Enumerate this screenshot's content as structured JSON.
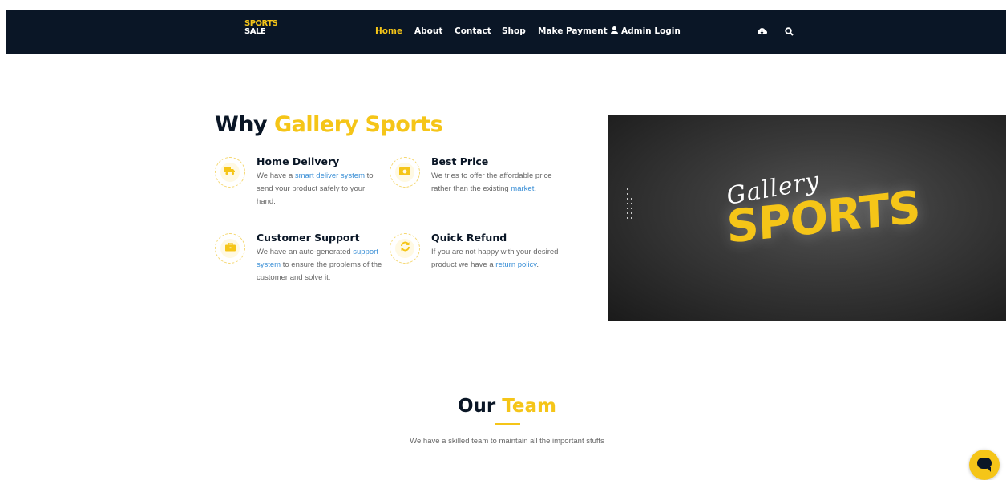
{
  "header": {
    "logo": {
      "line1": "SPORTS",
      "line2": "SALE"
    },
    "nav": [
      {
        "label": "Home",
        "active": true
      },
      {
        "label": "About"
      },
      {
        "label": "Contact"
      },
      {
        "label": "Shop"
      },
      {
        "label": "Make Payment"
      },
      {
        "label": "Admin Login",
        "icon": "user-icon"
      }
    ],
    "icons": [
      "cloud-download-icon",
      "search-icon"
    ]
  },
  "why": {
    "title_prefix": "Why",
    "title_highlight": "Gallery Sports",
    "features": [
      {
        "title": "Home Delivery",
        "icon": "truck-icon",
        "pre": "We have a ",
        "link": "smart deliver system",
        "post": " to send your product safely to your hand."
      },
      {
        "title": "Best Price",
        "icon": "money-icon",
        "pre": "We tries to offer the affordable price rather than the existing ",
        "link": "market",
        "post": "."
      },
      {
        "title": "Customer Support",
        "icon": "briefcase-icon",
        "pre": "We have an auto-generated ",
        "link": "support system",
        "post": " to ensure the problems of the customer and solve it."
      },
      {
        "title": "Quick Refund",
        "icon": "refresh-icon",
        "pre": "If you are not happy with your desired product we have a ",
        "link": "return policy",
        "post": "."
      }
    ]
  },
  "hero": {
    "script_text": "Gallery",
    "big_text": "SPORTS"
  },
  "team": {
    "title_prefix": "Our",
    "title_highlight": "Team",
    "subtitle": "We have a skilled team to maintain all the important stuffs"
  },
  "colors": {
    "navy": "#0a1626",
    "accent": "#f5c518",
    "link": "#3a8fd6"
  },
  "chat": {
    "icon": "chat-icon"
  }
}
